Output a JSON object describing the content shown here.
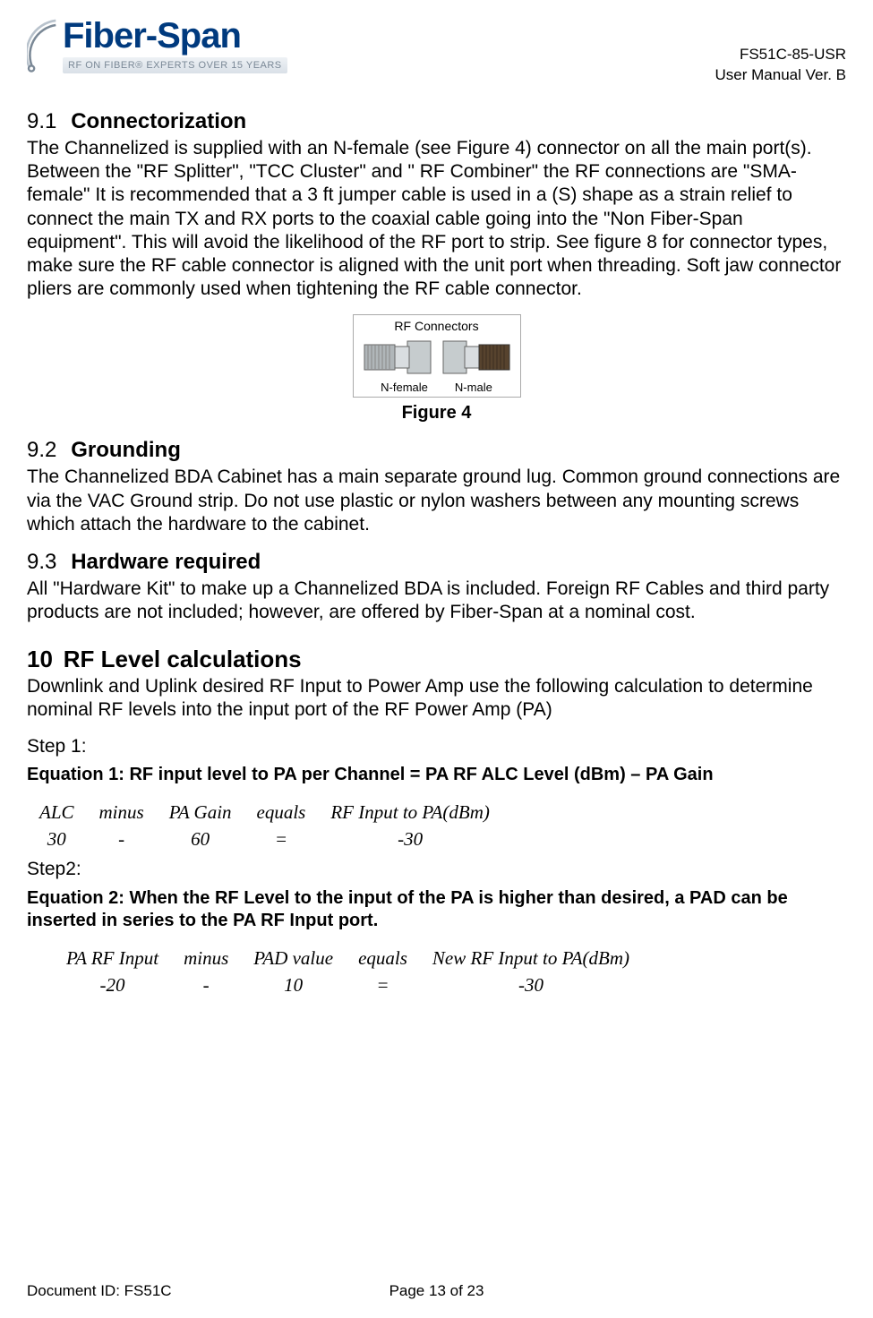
{
  "header": {
    "logo_main": "Fiber-Span",
    "logo_sub": "RF ON FIBER® EXPERTS OVER 15 YEARS",
    "doc_code": "FS51C-85-USR",
    "doc_ver": "User Manual Ver. B"
  },
  "s91": {
    "num": "9.1",
    "title": "Connectorization",
    "body": "The Channelized is supplied with an N-female (see Figure 4) connector on all the main port(s). Between the \"RF Splitter\", \"TCC Cluster\" and \" RF Combiner\" the RF  connections are \"SMA-female\" It is recommended that a 3 ft jumper cable is used in a (S) shape as a strain relief to connect the main TX and RX ports to the coaxial cable going into the \"Non Fiber-Span equipment\". This will avoid the likelihood of the RF port to strip.  See figure 8 for connector types, make sure the RF cable connector is aligned with the unit port when threading. Soft jaw connector pliers are commonly used when tightening the RF cable connector."
  },
  "fig4": {
    "title_top": "RF Connectors",
    "left_label": "N-female",
    "right_label": "N-male",
    "caption": "Figure 4"
  },
  "s92": {
    "num": "9.2",
    "title": "Grounding",
    "body": "The Channelized BDA Cabinet has a main separate ground lug.  Common ground connections are via the VAC Ground strip. Do not use plastic or nylon washers between any mounting screws which attach the hardware to the cabinet."
  },
  "s93": {
    "num": "9.3",
    "title": "Hardware required",
    "body": "All \"Hardware Kit\" to make up a Channelized BDA is included.  Foreign RF Cables and third party products are not included; however, are offered by Fiber-Span at a nominal cost."
  },
  "s10": {
    "num": "10",
    "title": "RF Level calculations",
    "intro": "Downlink and Uplink desired RF Input to Power Amp use the following calculation to determine nominal RF levels into the input port of the RF Power Amp (PA)"
  },
  "step1": "Step 1:",
  "eq1": {
    "title": "Equation 1:  RF input level to PA per Channel = PA RF ALC Level (dBm) – PA Gain",
    "h0": "ALC",
    "h1": "minus",
    "h2": "PA Gain",
    "h3": "equals",
    "h4": "RF Input to PA(dBm)",
    "v0": "30",
    "v1": "-",
    "v2": "60",
    "v3": "=",
    "v4": "-30"
  },
  "step2": "Step2:",
  "eq2": {
    "title": "Equation 2: When the RF Level to the input of the PA is higher than desired, a PAD can be inserted in series to the PA RF Input port.",
    "h0": "PA RF Input",
    "h1": "minus",
    "h2": "PAD value",
    "h3": "equals",
    "h4": "New RF Input to PA(dBm)",
    "v0": "-20",
    "v1": "-",
    "v2": "10",
    "v3": "=",
    "v4": "-30"
  },
  "footer": {
    "left": "Document ID: FS51C",
    "center": "Page 13 of 23"
  }
}
